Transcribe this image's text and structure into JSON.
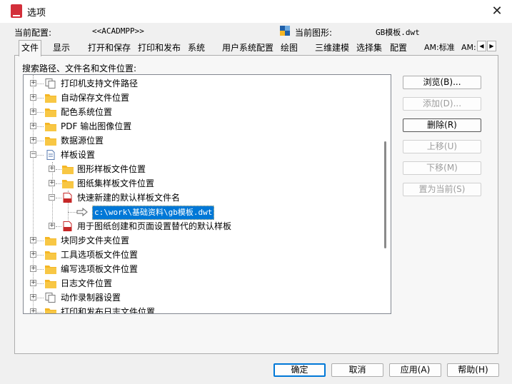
{
  "window": {
    "title": "选项",
    "close_glyph": "✕"
  },
  "header": {
    "current_profile_label": "当前配置:",
    "current_profile_value": "<<ACADMPP>>",
    "current_drawing_label": "当前图形:",
    "current_drawing_value": "GB模板.dwt"
  },
  "tabs": [
    {
      "label": "文件",
      "active": true
    },
    {
      "label": "显示"
    },
    {
      "label": "打开和保存"
    },
    {
      "label": "打印和发布"
    },
    {
      "label": "系统"
    },
    {
      "label": "用户系统配置"
    },
    {
      "label": "绘图"
    },
    {
      "label": "三维建模"
    },
    {
      "label": "选择集"
    },
    {
      "label": "配置"
    },
    {
      "label": "AM:标准"
    },
    {
      "label": "AM:"
    }
  ],
  "tab_scroll": {
    "left": "◀",
    "right": "▶"
  },
  "panel": {
    "label": "搜索路径、文件名和文件位置:"
  },
  "tree": {
    "items": [
      {
        "label": "打印机支持文件路径",
        "icon": "pages-icon",
        "expander": "+"
      },
      {
        "label": "自动保存文件位置",
        "icon": "folder-icon",
        "expander": "+"
      },
      {
        "label": "配色系统位置",
        "icon": "folder-icon",
        "expander": "+"
      },
      {
        "label": "PDF 输出图像位置",
        "icon": "folder-icon",
        "expander": "+"
      },
      {
        "label": "数据源位置",
        "icon": "folder-icon",
        "expander": "+"
      },
      {
        "label": "样板设置",
        "icon": "document-icon",
        "expander": "−"
      },
      {
        "label": "图形样板文件位置",
        "icon": "folder-icon",
        "expander": "+"
      },
      {
        "label": "图纸集样板文件位置",
        "icon": "folder-icon",
        "expander": "+"
      },
      {
        "label": "快速新建的默认样板文件名",
        "icon": "dwt-file-icon",
        "expander": "−"
      },
      {
        "label": "c:\\work\\基础资料\\gb模板.dwt",
        "icon": "arrow-icon"
      },
      {
        "label": "用于图纸创建和页面设置替代的默认样板",
        "icon": "dwt-file-icon",
        "expander": "+"
      },
      {
        "label": "块同步文件夹位置",
        "icon": "folder-icon",
        "expander": "+"
      },
      {
        "label": "工具选项板文件位置",
        "icon": "folder-icon",
        "expander": "+"
      },
      {
        "label": "编写选项板文件位置",
        "icon": "folder-icon",
        "expander": "+"
      },
      {
        "label": "日志文件位置",
        "icon": "folder-icon",
        "expander": "+"
      },
      {
        "label": "动作录制器设置",
        "icon": "pages-icon",
        "expander": "+"
      },
      {
        "label": "打印和发布日志文件位置",
        "icon": "folder-icon",
        "expander": "+"
      }
    ]
  },
  "side_buttons": {
    "browse": "浏览(B)...",
    "add": "添加(D)...",
    "remove": "删除(R)",
    "move_up": "上移(U)",
    "move_down": "下移(M)",
    "set_current": "置为当前(S)"
  },
  "bottom_buttons": {
    "ok": "确定",
    "cancel": "取消",
    "apply": "应用(A)",
    "help": "帮助(H)"
  },
  "colors": {
    "selection": "#0078d7",
    "folder": "#f5b625",
    "dwt_file": "#c62828"
  }
}
